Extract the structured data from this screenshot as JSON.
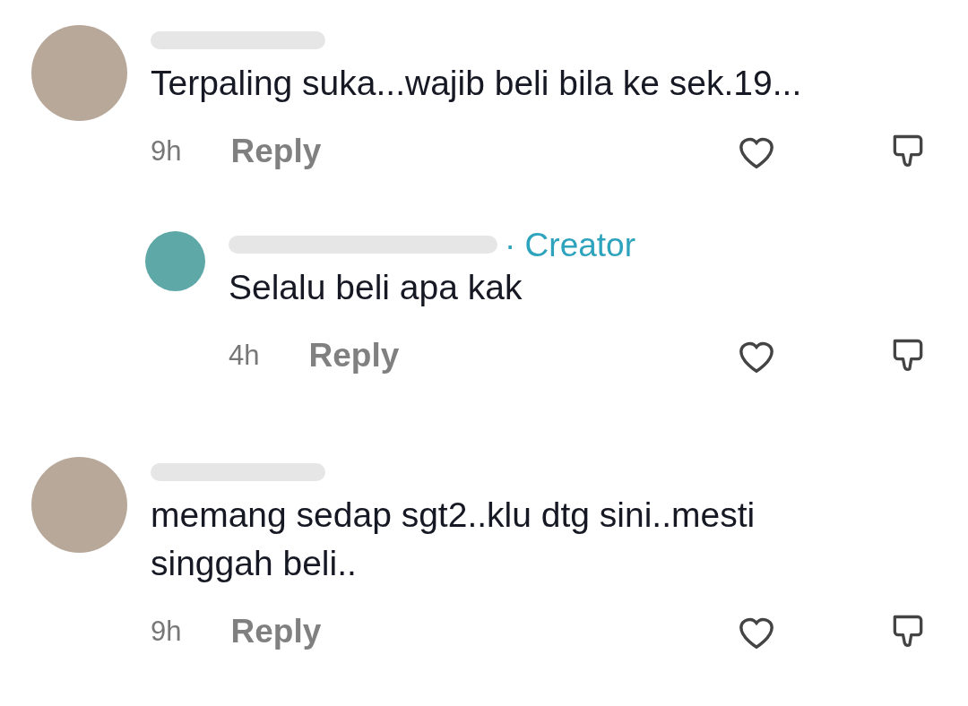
{
  "comments": [
    {
      "text": "Terpaling suka...wajib beli bila ke sek.19...",
      "time": "9h",
      "reply_label": "Reply",
      "replies": [
        {
          "badge": "· Creator",
          "text": "Selalu beli apa kak",
          "time": "4h",
          "reply_label": "Reply"
        }
      ]
    },
    {
      "text": "memang sedap sgt2..klu dtg sini..mesti singgah beli..",
      "time": "9h",
      "reply_label": "Reply"
    }
  ]
}
